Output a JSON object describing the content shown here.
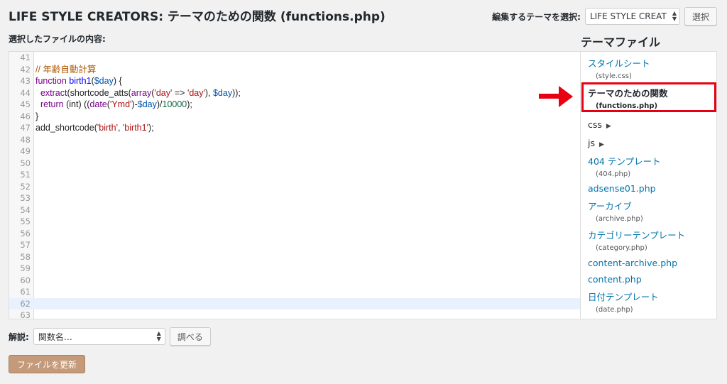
{
  "header": {
    "title": "LIFE STYLE CREATORS: テーマのための関数 (functions.php)",
    "select_theme_label": "編集するテーマを選択:",
    "selected_theme": "LIFE STYLE CREAT",
    "select_button": "選択"
  },
  "editor": {
    "heading": "選択したファイルの内容:",
    "line_numbers": [
      "41",
      "42",
      "43",
      "44",
      "45",
      "46",
      "47",
      "48",
      "49",
      "50",
      "51",
      "52",
      "53",
      "54",
      "55",
      "56",
      "57",
      "58",
      "59",
      "60",
      "61",
      "62",
      "63"
    ],
    "active_line": "62"
  },
  "sidebar": {
    "title": "テーマファイル",
    "files": [
      {
        "label": "スタイルシート",
        "sub": "(style.css)"
      },
      {
        "label": "テーマのための関数",
        "sub": "(functions.php)"
      },
      {
        "label": "css"
      },
      {
        "label": "js"
      },
      {
        "label": "404 テンプレート",
        "sub": "(404.php)"
      },
      {
        "label": "adsense01.php"
      },
      {
        "label": "アーカイブ",
        "sub": "(archive.php)"
      },
      {
        "label": "カテゴリーテンプレート",
        "sub": "(category.php)"
      },
      {
        "label": "content-archive.php"
      },
      {
        "label": "content.php"
      },
      {
        "label": "日付テンプレート",
        "sub": "(date.php)"
      }
    ]
  },
  "footer": {
    "doc_label": "解説:",
    "function_select": "関数名…",
    "lookup_button": "調べる",
    "update_button": "ファイルを更新"
  },
  "colors": {
    "highlight": "#e60012",
    "link": "#0073aa",
    "update_button": "#c49a7a"
  }
}
